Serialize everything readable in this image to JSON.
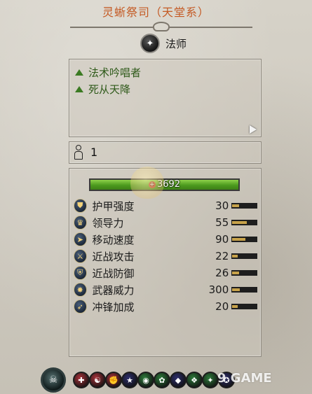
{
  "header": {
    "title": "灵蜥祭司（天堂系）"
  },
  "unit_class": {
    "label": "法师",
    "icon": "mage-icon"
  },
  "abilities": [
    {
      "label": "法术吟唱者"
    },
    {
      "label": "死从天降"
    }
  ],
  "unit_count": {
    "value": "1",
    "icon": "person-icon"
  },
  "health": {
    "value": "3692",
    "fill_fraction": 1.0,
    "colors": {
      "fill": "#5aa824"
    }
  },
  "stats": [
    {
      "label": "护甲强度",
      "value": "30",
      "fill": 0.25,
      "icon": "armor-icon"
    },
    {
      "label": "领导力",
      "value": "55",
      "fill": 0.55,
      "icon": "leadership-icon"
    },
    {
      "label": "移动速度",
      "value": "90",
      "fill": 0.5,
      "icon": "speed-icon"
    },
    {
      "label": "近战攻击",
      "value": "22",
      "fill": 0.22,
      "icon": "melee-attack-icon"
    },
    {
      "label": "近战防御",
      "value": "26",
      "fill": 0.25,
      "icon": "melee-defense-icon"
    },
    {
      "label": "武器威力",
      "value": "300",
      "fill": 0.3,
      "icon": "weapon-strength-icon"
    },
    {
      "label": "冲锋加成",
      "value": "20",
      "fill": 0.2,
      "icon": "charge-bonus-icon"
    }
  ],
  "bottom_icons": [
    {
      "name": "unit-portrait-icon"
    },
    {
      "name": "skill-icon-1",
      "color": "#a8323a"
    },
    {
      "name": "skill-icon-2",
      "color": "#a8323a"
    },
    {
      "name": "skill-icon-3",
      "color": "#a8323a"
    },
    {
      "name": "skill-icon-4",
      "color": "#2d2e6a"
    },
    {
      "name": "skill-icon-5",
      "color": "#2d7a3a"
    },
    {
      "name": "skill-icon-6",
      "color": "#2d7a3a"
    },
    {
      "name": "skill-icon-7",
      "color": "#2d2e6a"
    },
    {
      "name": "skill-icon-8",
      "color": "#2d7a3a"
    },
    {
      "name": "skill-icon-9",
      "color": "#2d7a3a"
    },
    {
      "name": "skill-icon-10",
      "color": "#2d2e6a"
    }
  ],
  "watermark": "9 GAME",
  "colors": {
    "title": "#c45a24",
    "ability_text": "#2f5a1a",
    "stat_bar_fill": "#c7a24a"
  }
}
